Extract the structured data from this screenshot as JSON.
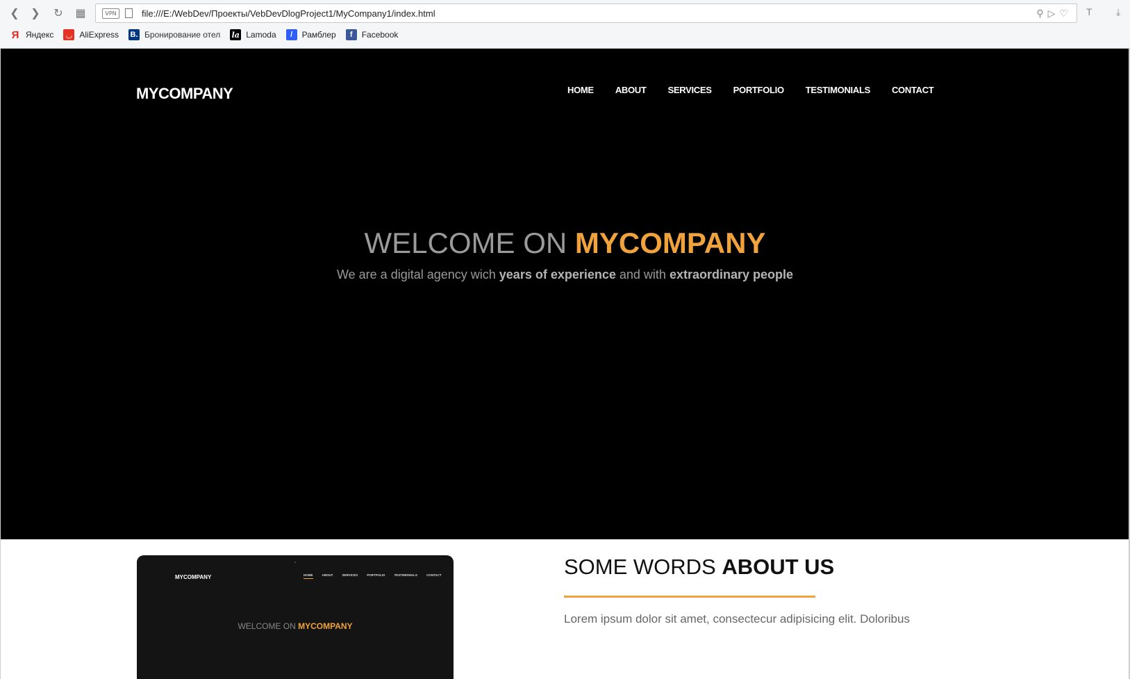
{
  "browser": {
    "url": "file:///E:/WebDev/Проекты/VebDevDlogProject1/MyCompany1/index.html",
    "vpn_label": "VPN",
    "bookmarks": [
      {
        "label": "Яндекс",
        "icon": "Я",
        "color": "#e52620"
      },
      {
        "label": "AliExpress",
        "icon": "◡",
        "color": "#e43225"
      },
      {
        "label": "Бронирование отел",
        "icon": "B.",
        "color": "#003580"
      },
      {
        "label": "Lamoda",
        "icon": "la",
        "color": "#000000"
      },
      {
        "label": "Рамблер",
        "icon": "/",
        "color": "#315efb"
      },
      {
        "label": "Facebook",
        "icon": "f",
        "color": "#3b5998"
      }
    ]
  },
  "site": {
    "brand": "MYCOMPANY",
    "menu": [
      "HOME",
      "ABOUT",
      "SERVICES",
      "PORTFOLIO",
      "TESTIMONIALS",
      "CONTACT"
    ],
    "hero": {
      "title_plain": "WELCOME ON ",
      "title_highlight": "MYCOMPANY",
      "sub_1": "We are a digital agency wich ",
      "sub_bold_1": "years of experience",
      "sub_2": " and with ",
      "sub_bold_2": "extraordinary people"
    },
    "about": {
      "title_plain": "SOME WORDS ",
      "title_bold": "ABOUT US",
      "text": "Lorem ipsum dolor sit amet, consectecur adipisicing elit. Doloribus"
    },
    "mockup": {
      "brand": "MYCOMPANY",
      "menu": [
        "HOME",
        "ABOUT",
        "SERVICES",
        "PORTFOLIO",
        "TESTIMONIALS",
        "CONTACT"
      ],
      "title_plain": "WELCOME ON ",
      "title_highlight": "MYCOMPANY"
    }
  },
  "colors": {
    "accent": "#f0a23c",
    "hero_bg": "#000000"
  }
}
